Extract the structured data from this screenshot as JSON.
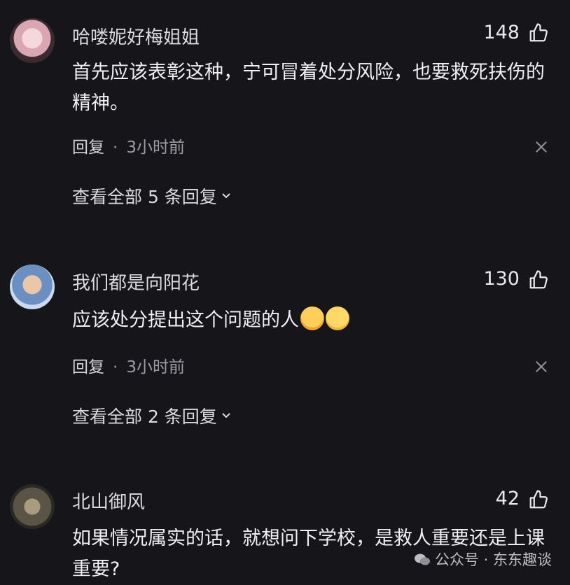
{
  "comments": [
    {
      "username": "哈喽妮好梅姐姐",
      "likes": "148",
      "text": "首先应该表彰这种，宁可冒着处分风险，也要救死扶伤的精神。",
      "reply_label": "回复",
      "separator": "·",
      "time": "3小时前",
      "view_replies": "查看全部 5 条回复"
    },
    {
      "username": "我们都是向阳花",
      "likes": "130",
      "text": "应该处分提出这个问题的人",
      "emojis": [
        "face-holding-back-tears-icon",
        "face-with-rolling-eyes-icon"
      ],
      "reply_label": "回复",
      "separator": "·",
      "time": "3小时前",
      "view_replies": "查看全部 2 条回复"
    },
    {
      "username": "北山御风",
      "likes": "42",
      "text": "如果情况属实的话，就想问下学校，是救人重要还是上课重要?"
    }
  ],
  "watermark": "公众号 · 东东趣谈",
  "colors": {
    "background": "#16161a",
    "text": "#f0f0f2",
    "muted": "#9c9ca3"
  }
}
